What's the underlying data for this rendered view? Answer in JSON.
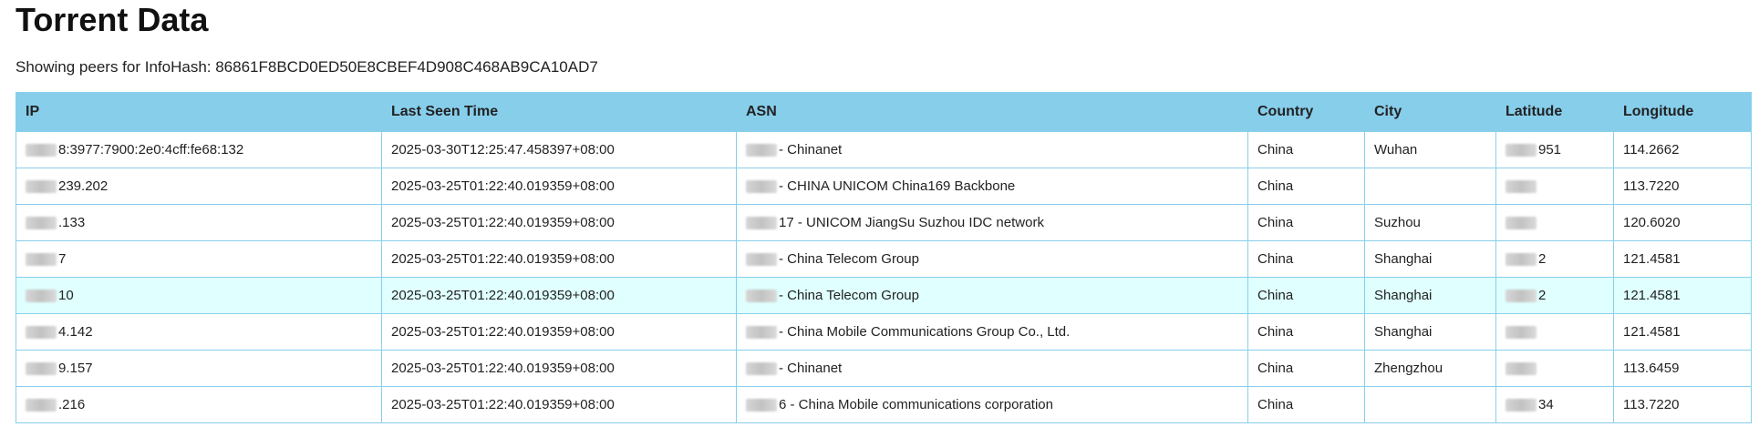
{
  "page": {
    "title": "Torrent Data",
    "subtitle": "Showing peers for InfoHash: 86861F8BCD0ED50E8CBEF4D908C468AB9CA10AD7"
  },
  "table": {
    "headers": [
      "IP",
      "Last Seen Time",
      "ASN",
      "Country",
      "City",
      "Latitude",
      "Longitude"
    ],
    "rows": [
      {
        "ip": "8:3977:7900:2e0:4cff:fe68:132",
        "time": "2025-03-30T12:25:47.458397+08:00",
        "asn": "- Chinanet",
        "country": "China",
        "city": "Wuhan",
        "lat": "951",
        "lon": "114.2662"
      },
      {
        "ip": "239.202",
        "time": "2025-03-25T01:22:40.019359+08:00",
        "asn": "- CHINA UNICOM China169 Backbone",
        "country": "China",
        "city": "",
        "lat": "",
        "lon": "113.7220"
      },
      {
        "ip": ".133",
        "time": "2025-03-25T01:22:40.019359+08:00",
        "asn": "17 - UNICOM JiangSu Suzhou IDC network",
        "country": "China",
        "city": "Suzhou",
        "lat": "",
        "lon": "120.6020"
      },
      {
        "ip": "7",
        "time": "2025-03-25T01:22:40.019359+08:00",
        "asn": "- China Telecom Group",
        "country": "China",
        "city": "Shanghai",
        "lat": "2",
        "lon": "121.4581"
      },
      {
        "ip": "10",
        "time": "2025-03-25T01:22:40.019359+08:00",
        "asn": "- China Telecom Group",
        "country": "China",
        "city": "Shanghai",
        "lat": "2",
        "lon": "121.4581"
      },
      {
        "ip": "4.142",
        "time": "2025-03-25T01:22:40.019359+08:00",
        "asn": "- China Mobile Communications Group Co., Ltd.",
        "country": "China",
        "city": "Shanghai",
        "lat": "",
        "lon": "121.4581"
      },
      {
        "ip": "9.157",
        "time": "2025-03-25T01:22:40.019359+08:00",
        "asn": "- Chinanet",
        "country": "China",
        "city": "Zhengzhou",
        "lat": "",
        "lon": "113.6459"
      },
      {
        "ip": ".216",
        "time": "2025-03-25T01:22:40.019359+08:00",
        "asn": "6 - China Mobile communications corporation",
        "country": "China",
        "city": "",
        "lat": "34",
        "lon": "113.7220"
      }
    ]
  },
  "colors": {
    "header_bg": "#87ceeb",
    "border": "#87cfea",
    "hover_row": "#e0ffff"
  }
}
